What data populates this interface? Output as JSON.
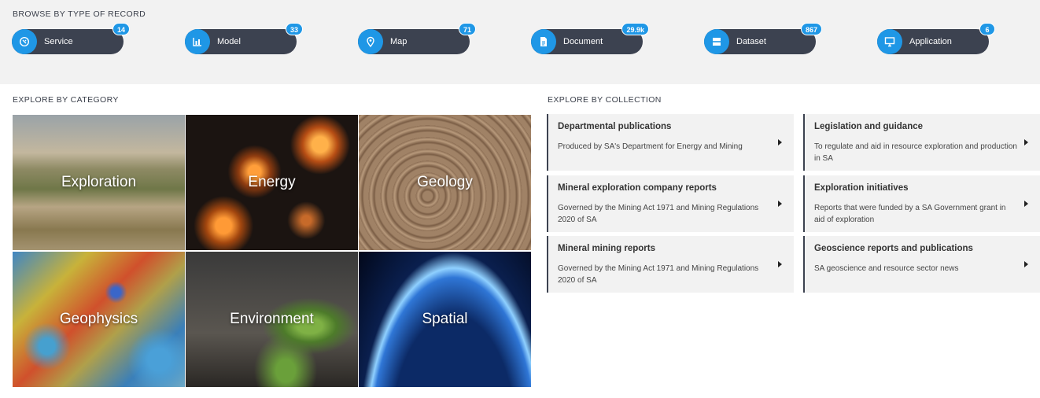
{
  "browse": {
    "title": "BROWSE BY TYPE OF RECORD",
    "types": [
      {
        "label": "Service",
        "count": "14",
        "icon": "service-icon"
      },
      {
        "label": "Model",
        "count": "33",
        "icon": "bar-chart-icon"
      },
      {
        "label": "Map",
        "count": "71",
        "icon": "map-pin-icon"
      },
      {
        "label": "Document",
        "count": "29.9k",
        "icon": "document-icon"
      },
      {
        "label": "Dataset",
        "count": "867",
        "icon": "database-icon"
      },
      {
        "label": "Application",
        "count": "6",
        "icon": "monitor-icon"
      }
    ]
  },
  "category": {
    "title": "EXPLORE BY CATEGORY",
    "tiles": [
      "Exploration",
      "Energy",
      "Geology",
      "Geophysics",
      "Environment",
      "Spatial"
    ]
  },
  "collection": {
    "title": "EXPLORE BY COLLECTION",
    "cards": [
      {
        "title": "Departmental publications",
        "desc": "Produced by SA's Department for Energy and Mining"
      },
      {
        "title": "Legislation and guidance",
        "desc": "To regulate and aid in resource exploration and production in SA"
      },
      {
        "title": "Mineral exploration company reports",
        "desc": "Governed by the Mining Act 1971 and Mining Regulations 2020 of SA"
      },
      {
        "title": "Exploration initiatives",
        "desc": "Reports that were funded by a SA Government grant in aid of exploration"
      },
      {
        "title": "Mineral mining reports",
        "desc": "Governed by the Mining Act 1971 and Mining Regulations 2020 of SA"
      },
      {
        "title": "Geoscience reports and publications",
        "desc": "SA geoscience and resource sector news"
      }
    ]
  },
  "colors": {
    "accent": "#1f97e6",
    "pill": "#3c4250",
    "panel": "#f2f2f2"
  }
}
